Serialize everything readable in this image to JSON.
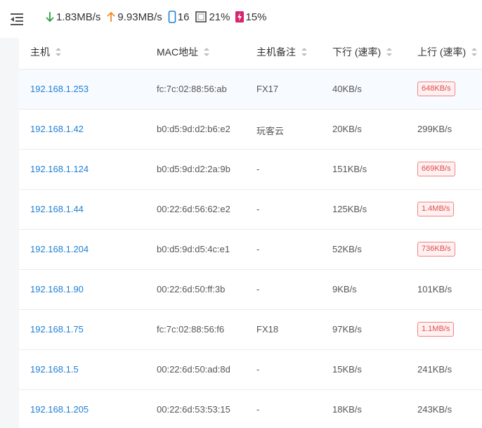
{
  "header": {
    "download_rate": "1.83MB/s",
    "upload_rate": "9.93MB/s",
    "devices_count": "16",
    "cpu_usage": "21%",
    "memory_usage": "15%"
  },
  "table": {
    "columns": [
      "主机",
      "MAC地址",
      "主机备注",
      "下行 (速率)",
      "上行 (速率)"
    ],
    "rows": [
      {
        "host": "192.168.1.253",
        "mac": "fc:7c:02:88:56:ab",
        "note": "FX17",
        "down": "40KB/s",
        "up": "648KB/s",
        "up_high": true
      },
      {
        "host": "192.168.1.42",
        "mac": "b0:d5:9d:d2:b6:e2",
        "note": "玩客云",
        "down": "20KB/s",
        "up": "299KB/s",
        "up_high": false
      },
      {
        "host": "192.168.1.124",
        "mac": "b0:d5:9d:d2:2a:9b",
        "note": "-",
        "down": "151KB/s",
        "up": "669KB/s",
        "up_high": true
      },
      {
        "host": "192.168.1.44",
        "mac": "00:22:6d:56:62:e2",
        "note": "-",
        "down": "125KB/s",
        "up": "1.4MB/s",
        "up_high": true
      },
      {
        "host": "192.168.1.204",
        "mac": "b0:d5:9d:d5:4c:e1",
        "note": "-",
        "down": "52KB/s",
        "up": "736KB/s",
        "up_high": true
      },
      {
        "host": "192.168.1.90",
        "mac": "00:22:6d:50:ff:3b",
        "note": "-",
        "down": "9KB/s",
        "up": "101KB/s",
        "up_high": false
      },
      {
        "host": "192.168.1.75",
        "mac": "fc:7c:02:88:56:f6",
        "note": "FX18",
        "down": "97KB/s",
        "up": "1.1MB/s",
        "up_high": true
      },
      {
        "host": "192.168.1.5",
        "mac": "00:22:6d:50:ad:8d",
        "note": "-",
        "down": "15KB/s",
        "up": "241KB/s",
        "up_high": false
      },
      {
        "host": "192.168.1.205",
        "mac": "00:22:6d:53:53:15",
        "note": "-",
        "down": "18KB/s",
        "up": "243KB/s",
        "up_high": false
      }
    ]
  },
  "colors": {
    "link": "#1e7fd6",
    "download": "#2e9e3f",
    "upload": "#f08a24",
    "devices": "#1e7fd6",
    "memory": "#d6246e",
    "badge_text": "#e34b4b"
  },
  "icons": {
    "menu": "menu-fold-icon",
    "download": "arrow-down-icon",
    "upload": "arrow-up-icon",
    "devices": "phone-icon",
    "cpu": "cpu-square-icon",
    "memory": "memory-bolt-icon",
    "sort": "sort-caret-icon"
  }
}
